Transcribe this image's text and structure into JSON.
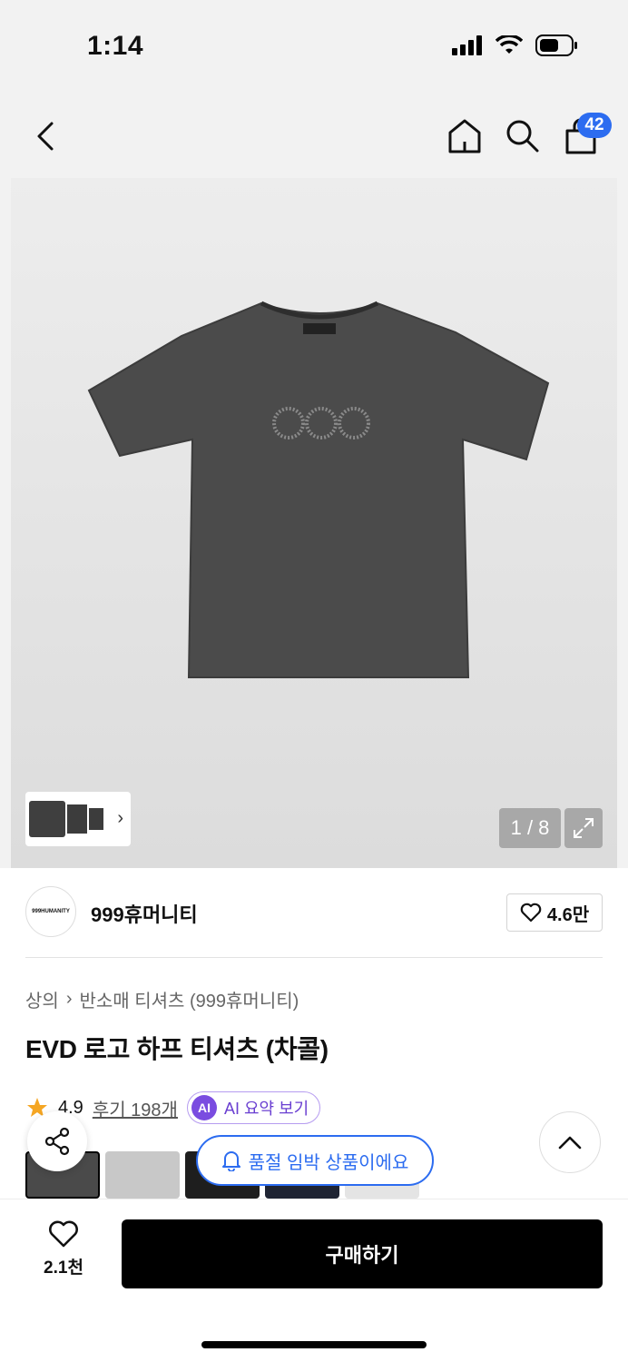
{
  "status_bar": {
    "time": "1:14"
  },
  "nav": {
    "cart_count": "42"
  },
  "gallery": {
    "counter": "1 / 8"
  },
  "brand": {
    "logo_text": "999HUMANITY",
    "name": "999휴머니티",
    "likes": "4.6만"
  },
  "breadcrumb": {
    "category": "상의",
    "subcategory": "반소매 티셔츠 (999휴머니티)"
  },
  "product": {
    "title": "EVD 로고 하프 티셔츠 (차콜)",
    "rating": "4.9",
    "reviews": "후기 198개",
    "ai_summary": "AI 요약 보기",
    "ai_badge": "AI"
  },
  "notice": {
    "soldout": "품절 임박 상품이에요"
  },
  "bottom": {
    "wish_count": "2.1천",
    "buy_label": "구매하기"
  },
  "colors": {
    "accent": "#2c6cf0",
    "ai": "#7a4ce0",
    "star": "#f5a623"
  }
}
